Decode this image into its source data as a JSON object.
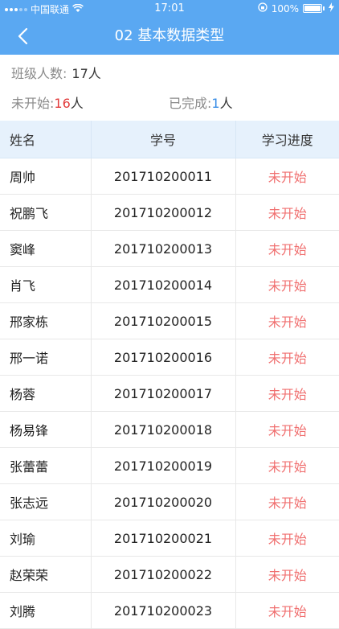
{
  "status_bar": {
    "carrier": "中国联通",
    "time": "17:01",
    "battery": "100%"
  },
  "nav": {
    "title": "02 基本数据类型"
  },
  "summary": {
    "class_count_label": "班级人数:",
    "class_count_value": "17人",
    "not_started_label": "未开始:",
    "not_started_num": "16",
    "not_started_unit": "人",
    "completed_label": "已完成:",
    "completed_num": "1",
    "completed_unit": "人"
  },
  "table": {
    "headers": [
      "姓名",
      "学号",
      "学习进度"
    ],
    "rows": [
      {
        "name": "周帅",
        "id": "201710200011",
        "progress": "未开始"
      },
      {
        "name": "祝鹏飞",
        "id": "201710200012",
        "progress": "未开始"
      },
      {
        "name": "窦峰",
        "id": "201710200013",
        "progress": "未开始"
      },
      {
        "name": "肖飞",
        "id": "201710200014",
        "progress": "未开始"
      },
      {
        "name": "邢家栋",
        "id": "201710200015",
        "progress": "未开始"
      },
      {
        "name": "邢一诺",
        "id": "201710200016",
        "progress": "未开始"
      },
      {
        "name": "杨蓉",
        "id": "201710200017",
        "progress": "未开始"
      },
      {
        "name": "杨易锋",
        "id": "201710200018",
        "progress": "未开始"
      },
      {
        "name": "张蕾蕾",
        "id": "201710200019",
        "progress": "未开始"
      },
      {
        "name": "张志远",
        "id": "201710200020",
        "progress": "未开始"
      },
      {
        "name": "刘瑜",
        "id": "201710200021",
        "progress": "未开始"
      },
      {
        "name": "赵荣荣",
        "id": "201710200022",
        "progress": "未开始"
      },
      {
        "name": "刘腾",
        "id": "201710200023",
        "progress": "未开始"
      }
    ]
  },
  "colors": {
    "header_bg": "#5aa8f2",
    "not_started_text": "#f07070",
    "table_header_bg": "#e6f1fc"
  }
}
